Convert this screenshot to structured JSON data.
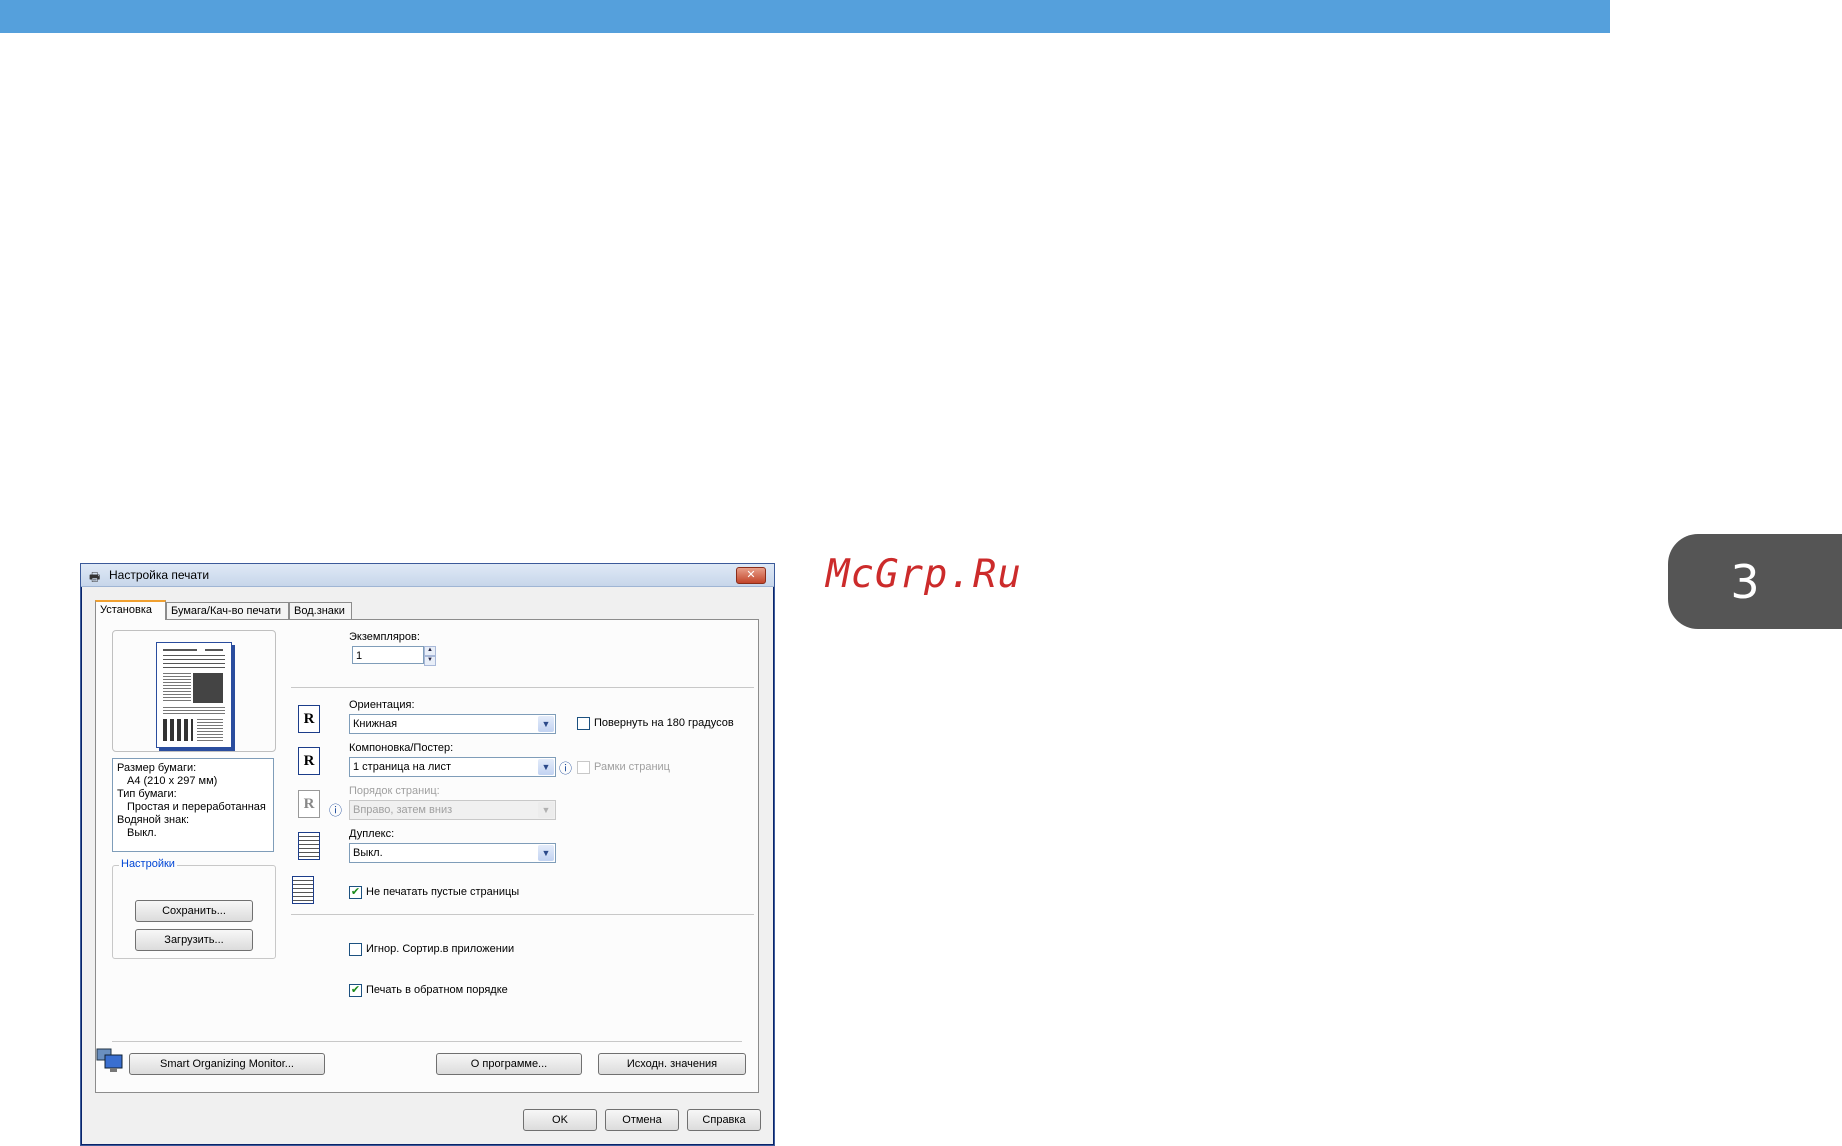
{
  "watermark": "McGrp.Ru",
  "chapter_number": "3",
  "dialog": {
    "title": "Настройка печати",
    "close": "✕",
    "tabs": [
      "Установка",
      "Бумага/Кач-во печати",
      "Вод.знаки"
    ],
    "info": {
      "paper_size_label": "Размер бумаги:",
      "paper_size_value": "A4 (210 x 297 мм)",
      "paper_type_label": "Тип бумаги:",
      "paper_type_value": "Простая и переработанная",
      "watermark_label": "Водяной знак:",
      "watermark_value": "Выкл."
    },
    "settings_group": {
      "label": "Настройки",
      "save": "Сохранить...",
      "load": "Загрузить..."
    },
    "copies_label": "Экземпляров:",
    "copies_value": "1",
    "orientation_label": "Ориентация:",
    "orientation_value": "Книжная",
    "rotate180_label": "Повернуть на 180 градусов",
    "layout_label": "Компоновка/Постер:",
    "layout_value": "1 страница на лист",
    "page_borders_label": "Рамки страниц",
    "page_order_label": "Порядок страниц:",
    "page_order_value": "Вправо, затем вниз",
    "duplex_label": "Дуплекс:",
    "duplex_value": "Выкл.",
    "skip_blank_label": "Не печатать пустые страницы",
    "ignore_collate_label": "Игнор. Сортир.в приложении",
    "reverse_order_label": "Печать в обратном порядке",
    "smart_monitor": "Smart Organizing Monitor...",
    "about": "О программе...",
    "defaults": "Исходн. значения",
    "ok": "OK",
    "cancel": "Отмена",
    "help": "Справка",
    "check_mark": "✔",
    "r_letter": "R"
  }
}
